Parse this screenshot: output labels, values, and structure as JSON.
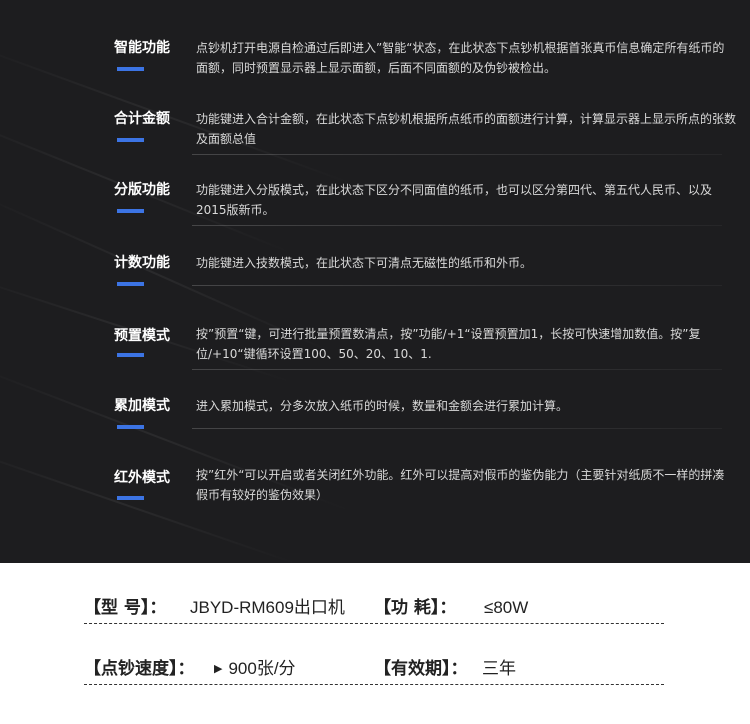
{
  "features": [
    {
      "name": "智能功能",
      "desc": "点钞机打开电源自检通过后即进入”智能“状态，在此状态下点钞机根据首张真币信息确定所有纸币的面额，同时预置显示器上显示面额，后面不同面额的及伪钞被检出。"
    },
    {
      "name": "合计金额",
      "desc": "功能键进入合计金额，在此状态下点钞机根据所点纸币的面额进行计算，计算显示器上显示所点的张数及面额总值"
    },
    {
      "name": "分版功能",
      "desc": "功能键进入分版模式，在此状态下区分不同面值的纸币，也可以区分第四代、第五代人民币、以及2015版新币。"
    },
    {
      "name": "计数功能",
      "desc": "功能键进入技数模式，在此状态下可清点无磁性的纸币和外币。"
    },
    {
      "name": "预置模式",
      "desc": "按”预置“键，可进行批量预置数清点，按”功能/+1“设置预置加1，长按可快速增加数值。按”复位/+10“键循环设置100、50、20、10、1."
    },
    {
      "name": "累加模式",
      "desc": "进入累加模式，分多次放入纸币的时候，数量和金额会进行累加计算。"
    },
    {
      "name": "红外模式",
      "desc": "按”红外“可以开启或者关闭红外功能。红外可以提高对假币的鉴伪能力（主要针对纸质不一样的拼凑假币有较好的鉴伪效果）"
    }
  ],
  "specs": {
    "model_label": "【型 号】：",
    "model_value": "JBYD-RM609出口机",
    "power_label": "【功 耗】：",
    "power_value": "≤80W",
    "speed_label": "【点钞速度】：",
    "speed_value": "900张/分",
    "warranty_label": "【有效期】：",
    "warranty_value": "三年"
  },
  "colors": {
    "background_dark": "#1d1d1f",
    "accent_bar": "#3c74e4",
    "title_text": "#ffffff",
    "body_text": "#d9d9d9"
  }
}
